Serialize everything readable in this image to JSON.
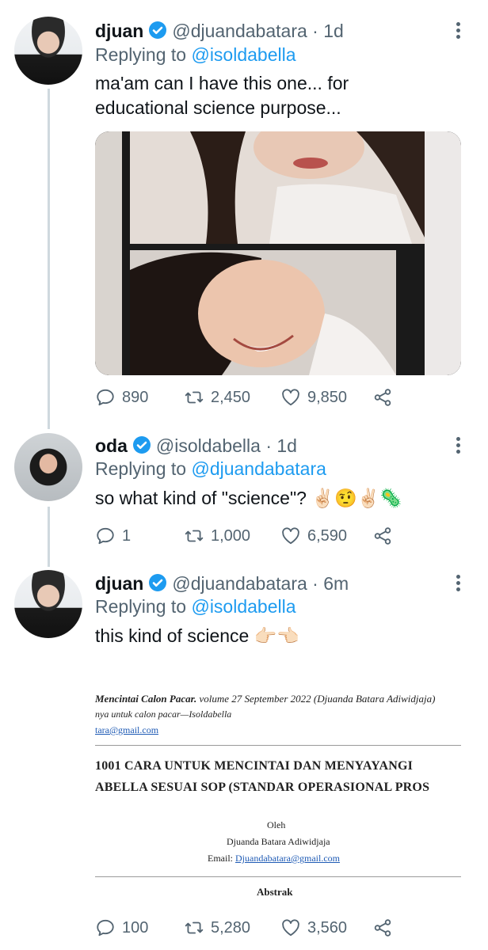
{
  "tweets": [
    {
      "name": "djuan",
      "handle": "@djuandabatara",
      "time": "· 1d",
      "replying_prefix": "Replying to",
      "replying_to": "@isoldabella",
      "text_lines": [
        "ma'am can I have this one... for",
        "educational science purpose..."
      ],
      "replies": "890",
      "retweets": "2,450",
      "likes": "9,850"
    },
    {
      "name": "oda",
      "handle": "@isoldabella",
      "time": "· 1d",
      "replying_prefix": "Replying to",
      "replying_to": "@djuandabatara",
      "text": "so what kind of \"science\"? ✌🏻🤨✌🏻🦠",
      "replies": "1",
      "retweets": "1,000",
      "likes": "6,590"
    },
    {
      "name": "djuan",
      "handle": "@djuandabatara",
      "time": "· 6m",
      "replying_prefix": "Replying to",
      "replying_to": "@isoldabella",
      "text": "this kind of science 👉🏻👈🏻",
      "replies": "100",
      "retweets": "5,280",
      "likes": "3,560"
    }
  ],
  "document": {
    "citation_title": "Mencintai Calon Pacar.",
    "citation_rest": "volume 27 September 2022 (Djuanda Batara Adiwidjaja)",
    "citation_line2": "nya untuk calon pacar—Isoldabella",
    "citation_email": "tara@gmail.com",
    "title_line1": "1001 CARA UNTUK MENCINTAI DAN MENYAYANGI",
    "title_line2": "ABELLA SESUAI SOP (STANDAR OPERASIONAL PROS",
    "by_label": "Oleh",
    "author": "Djuanda Batara Adiwidjaja",
    "email_label": "Email:",
    "email": "Djuandabatara@gmail.com",
    "abstract_label": "Abstrak"
  },
  "colors": {
    "accent": "#1d9bf0",
    "muted": "#536471",
    "text": "#0f1419",
    "line": "#cfd9de"
  },
  "icons": [
    "verified-badge-icon",
    "more-options-icon",
    "reply-icon",
    "retweet-icon",
    "like-icon",
    "share-icon"
  ]
}
